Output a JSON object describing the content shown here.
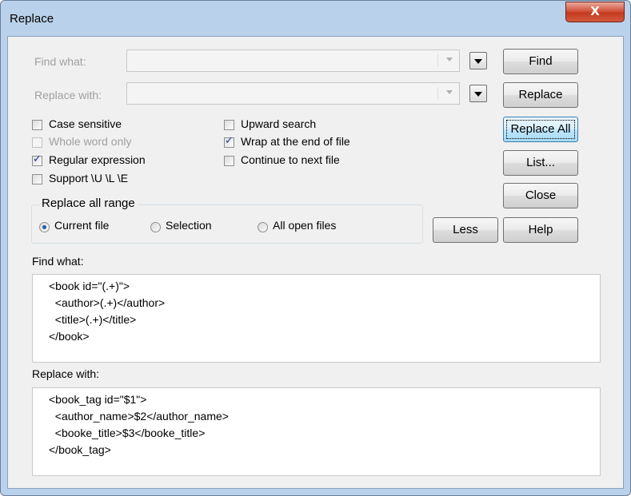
{
  "window": {
    "title": "Replace",
    "close_glyph": "X"
  },
  "find_what": {
    "label": "Find what:",
    "value": ""
  },
  "replace_with": {
    "label": "Replace with:",
    "value": ""
  },
  "buttons": {
    "find": "Find",
    "replace": "Replace",
    "replace_all": "Replace All",
    "list": "List...",
    "close": "Close",
    "less": "Less",
    "help": "Help"
  },
  "options": {
    "case_sensitive": {
      "label": "Case sensitive",
      "checked": false
    },
    "whole_word_only": {
      "label": "Whole word only",
      "checked": false,
      "disabled": true
    },
    "regular_expression": {
      "label": "Regular expression",
      "checked": true
    },
    "support_ule": {
      "label": "Support \\U \\L \\E",
      "checked": false
    },
    "upward_search": {
      "label": "Upward search",
      "checked": false
    },
    "wrap_end_of_file": {
      "label": "Wrap at the end of file",
      "checked": true
    },
    "continue_next_file": {
      "label": "Continue to next file",
      "checked": false
    }
  },
  "range": {
    "label": "Replace all range",
    "current_file": "Current file",
    "selection": "Selection",
    "all_open_files": "All open files",
    "selected": "current_file"
  },
  "find_text": {
    "label": "Find what:",
    "lines": [
      "<book id=\"(.+)\">",
      "  <author>(.+)</author>",
      "  <title>(.+)</title>",
      "</book>"
    ]
  },
  "replace_text": {
    "label": "Replace with:",
    "lines": [
      "<book_tag id=\"$1\">",
      "  <author_name>$2</author_name>",
      "  <booke_title>$3</booke_title>",
      "</book_tag>"
    ]
  },
  "colors": {
    "title_bar": "#b9d1ea",
    "dialog_bg": "#f0f0f0",
    "close_red": "#c43a1f",
    "default_button": "#a7d9f5"
  }
}
